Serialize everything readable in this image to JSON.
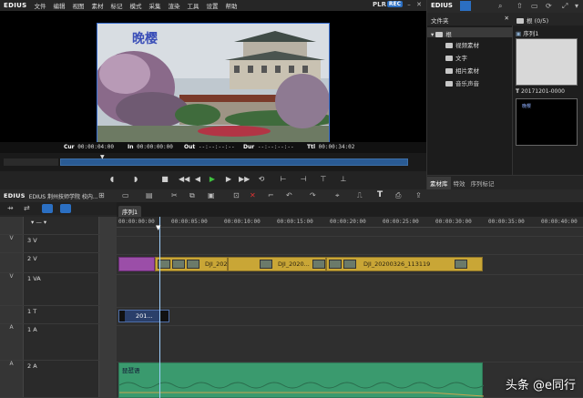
{
  "app": {
    "logo": "EDIUS",
    "menus": [
      "文件",
      "编辑",
      "视图",
      "素材",
      "标记",
      "模式",
      "采集",
      "渲染",
      "工具",
      "设置",
      "帮助"
    ],
    "plr": "PLR",
    "rec": "REC"
  },
  "preview": {
    "overlay_title": "晚樱",
    "timecodes": {
      "cur_label": "Cur",
      "cur": "00:00:04:00",
      "in_label": "In",
      "in": "00:00:00:00",
      "out_label": "Out",
      "out": "--:--:--:--",
      "dur_label": "Dur",
      "dur": "--:--:--:--",
      "ttl_label": "Ttl",
      "ttl": "00:00:34:02"
    }
  },
  "asset_panel": {
    "logo": "EDIUS",
    "folder_header": "文件夹",
    "root": "根",
    "folders": [
      "视频素材",
      "文字",
      "相片素材",
      "音乐声音"
    ],
    "bin_header": "根 (0/5)",
    "clip1_label": "序列1",
    "clip2_label": "20171201-0000",
    "clip2_sub": "晚樱",
    "tabs": [
      "素材库",
      "特效",
      "序列标记"
    ]
  },
  "timeline": {
    "title": "EDIUS 荆州技师学院 校内...",
    "sequence_tab": "序列1",
    "ruler": [
      "00:00:00:00",
      "00:00:05:00",
      "00:00:10:00",
      "00:00:15:00",
      "00:00:20:00",
      "00:00:25:00",
      "00:00:30:00",
      "00:00:35:00",
      "00:00:40:00"
    ],
    "tracks": [
      {
        "side": "V",
        "name": "3 V"
      },
      {
        "side": "",
        "name": "2 V"
      },
      {
        "side": "V",
        "name": "1 VA"
      },
      {
        "side": "",
        "name": "1 T"
      },
      {
        "side": "A",
        "name": "1 A"
      },
      {
        "side": "A",
        "name": "2 A"
      }
    ],
    "clips": {
      "v1": "DJI_20200...",
      "v2": "DJI_2020...",
      "v3": "DJI_20200326_113119",
      "title": "201...",
      "audio": "琵琶语"
    }
  },
  "watermark": "头条 @e同行"
}
